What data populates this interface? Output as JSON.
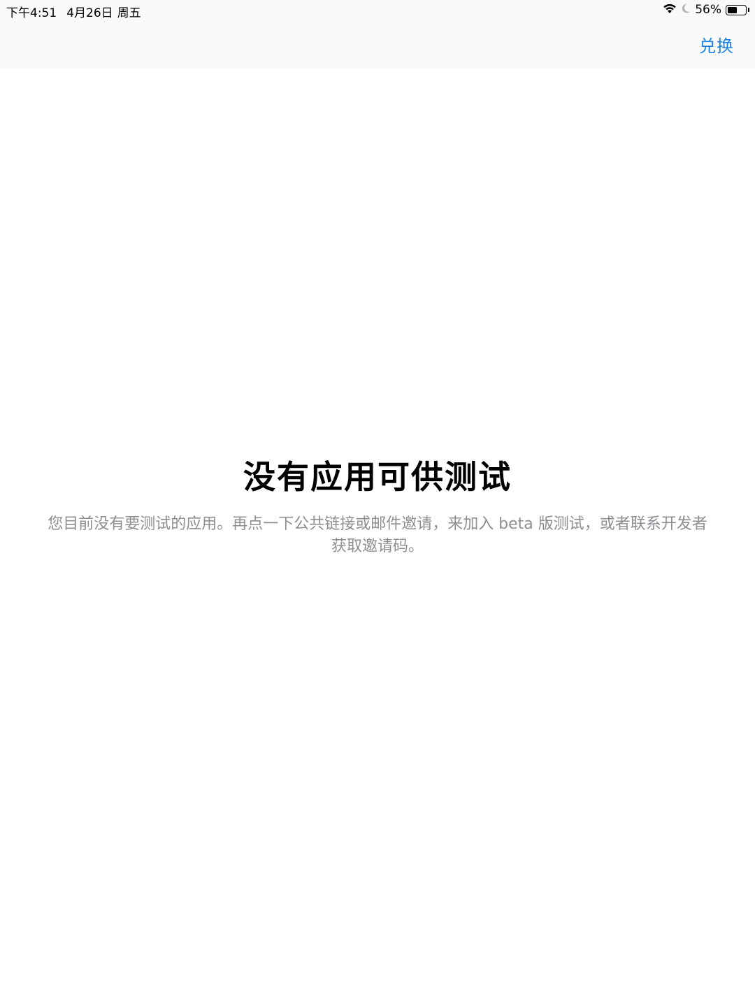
{
  "status_bar": {
    "time": "下午4:51",
    "date": "4月26日",
    "weekday": "周五",
    "battery_percent": "56%",
    "battery_level": 0.56,
    "icons": [
      "wifi-icon",
      "moon-icon",
      "battery-icon"
    ]
  },
  "nav": {
    "redeem_label": "兑换"
  },
  "empty_state": {
    "title": "没有应用可供测试",
    "message": "您目前没有要测试的应用。再点一下公共链接或邮件邀请，来加入 beta 版测试，或者联系开发者获取邀请码。"
  },
  "colors": {
    "accent": "#1a82e2",
    "secondary_text": "#8e8e93",
    "nav_background": "#fafafa"
  }
}
